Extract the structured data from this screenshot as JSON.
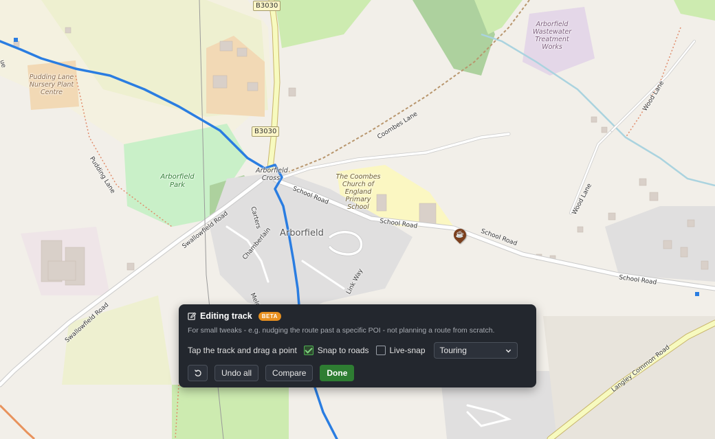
{
  "map": {
    "shields": [
      "B3030",
      "B3030"
    ],
    "road_labels": {
      "coombes_lane": "Coombes Lane",
      "wood_lane_top": "Wood Lane",
      "wood_lane_right": "Wood Lane",
      "school_road_1": "School Road",
      "school_road_2": "School Road",
      "school_road_3": "School Road",
      "school_road_4": "School Road",
      "swallowfield_road_1": "Swallowfield Road",
      "swallowfield_road_2": "Swallowfield Road",
      "pudding_lane": "Pudding Lane",
      "link_way": "Link Way",
      "chamberlain": "Chamberlain",
      "carters": "Carters",
      "langley_common_road": "Langley Common Road",
      "lane_left": "ue",
      "meld": "Meld"
    },
    "area_labels": {
      "nursery": "Pudding Lane Nursery Plant Centre",
      "wastewater": "Arborfield Wastewater Treatment Works",
      "school": "The Coombes Church of England Primary School",
      "park": "Arborfield Park",
      "cross": "Arborfield Cross"
    },
    "place_label": "Arborfield",
    "poi_icon": "cafe-icon",
    "route_color": "#2a7de1"
  },
  "panel": {
    "title": "Editing track",
    "badge": "BETA",
    "description": "For small tweaks - e.g. nudging the route past a specific POI - not planning a route from scratch.",
    "instruction": "Tap the track and drag a point",
    "snap_label": "Snap to roads",
    "snap_checked": true,
    "livesnap_label": "Live-snap",
    "livesnap_checked": false,
    "profile_value": "Touring",
    "undo_all_label": "Undo all",
    "compare_label": "Compare",
    "done_label": "Done",
    "icons": {
      "title": "edit-icon",
      "reset": "rotate-ccw-icon",
      "select": "chevron-down-icon"
    },
    "colors": {
      "panel_bg": "#23272e",
      "badge": "#e8901f",
      "done": "#2e7d32"
    }
  }
}
